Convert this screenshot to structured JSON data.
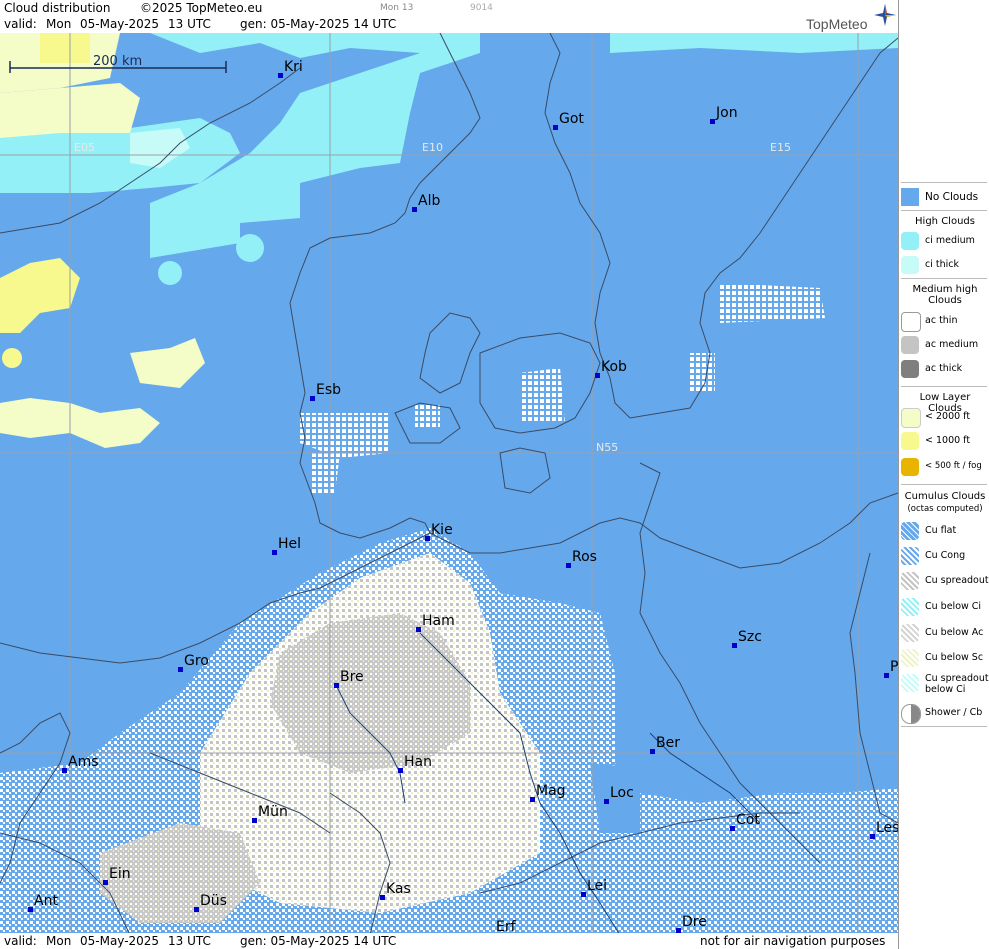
{
  "header": {
    "title": "Cloud distribution",
    "copyright": "©2025 TopMeteo.eu",
    "run_small": "Mon 13",
    "code_small": "9014",
    "valid_label": "valid:",
    "valid_day": "Mon",
    "valid_date": "05-May-2025",
    "valid_time": "13 UTC",
    "gen_label": "gen: 05-May-2025 14 UTC",
    "logo_text": "TopMeteo"
  },
  "footer": {
    "valid_label": "valid:",
    "valid_day": "Mon",
    "valid_date": "05-May-2025",
    "valid_time": "13 UTC",
    "gen_label": "gen: 05-May-2025 14 UTC",
    "disclaimer": "not for air navigation purposes"
  },
  "map": {
    "scale_label": "200 km",
    "grid_labels": [
      "E05",
      "E10",
      "E15",
      "N55"
    ],
    "cities": [
      {
        "label": "Kri"
      },
      {
        "label": "Got"
      },
      {
        "label": "Jon"
      },
      {
        "label": "Alb"
      },
      {
        "label": "Esb"
      },
      {
        "label": "Kob"
      },
      {
        "label": "Hel"
      },
      {
        "label": "Kie"
      },
      {
        "label": "Ros"
      },
      {
        "label": "Ham"
      },
      {
        "label": "Szc"
      },
      {
        "label": "Gro"
      },
      {
        "label": "Bre"
      },
      {
        "label": "Ber"
      },
      {
        "label": "Ams"
      },
      {
        "label": "Han"
      },
      {
        "label": "Mag"
      },
      {
        "label": "Loc"
      },
      {
        "label": "Mün"
      },
      {
        "label": "Cot"
      },
      {
        "label": "Les"
      },
      {
        "label": "Ein"
      },
      {
        "label": "Kas"
      },
      {
        "label": "Lei"
      },
      {
        "label": "Ant"
      },
      {
        "label": "Düs"
      },
      {
        "label": "Dre"
      },
      {
        "label": "Erf"
      },
      {
        "label": "P"
      }
    ]
  },
  "legend": {
    "no_clouds": "No Clouds",
    "high_title": "High Clouds",
    "high": [
      "ci medium",
      "ci thick"
    ],
    "medium_title": "Medium high Clouds",
    "medium": [
      "ac thin",
      "ac medium",
      "ac thick"
    ],
    "low_title": "Low Layer Clouds",
    "low": [
      "< 2000 ft",
      "< 1000 ft",
      "< 500 ft / fog"
    ],
    "cumulus_title": "Cumulus Clouds",
    "cumulus_sub": "(octas computed)",
    "cumulus": [
      "Cu flat",
      "Cu Cong",
      "Cu spreadout",
      "Cu below Ci",
      "Cu below Ac",
      "Cu below Sc",
      "Cu spreadout below Ci",
      "Shower / Cb"
    ],
    "colors": {
      "no_clouds": "#65a9ec",
      "ci_medium": "#93f0f7",
      "ci_thick": "#c6fbf8",
      "ac_thin": "#ffffff",
      "ac_medium": "#c4c4c4",
      "ac_thick": "#7f7f7f",
      "low_2000": "#f4fcc7",
      "low_1000": "#f7f98f",
      "low_500": "#e9b400"
    }
  }
}
